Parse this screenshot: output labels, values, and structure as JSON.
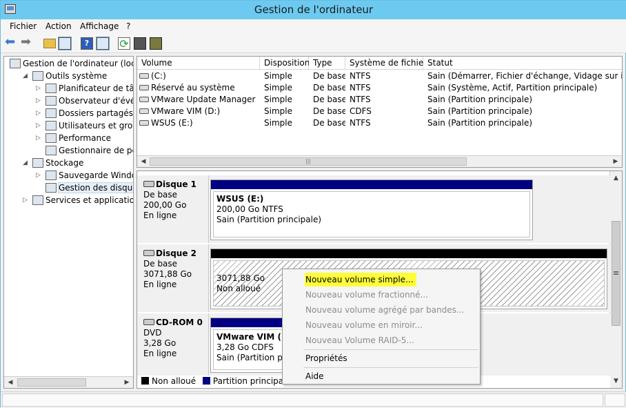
{
  "window": {
    "title": "Gestion de l'ordinateur"
  },
  "menu": [
    "Fichier",
    "Action",
    "Affichage",
    "?"
  ],
  "tree": [
    {
      "label": "Gestion de l'ordinateur (local)",
      "level": 0,
      "exp": ""
    },
    {
      "label": "Outils système",
      "level": 1,
      "exp": "◢"
    },
    {
      "label": "Planificateur de tâches",
      "level": 2,
      "exp": "▷"
    },
    {
      "label": "Observateur d'événeme",
      "level": 2,
      "exp": "▷"
    },
    {
      "label": "Dossiers partagés",
      "level": 2,
      "exp": "▷"
    },
    {
      "label": "Utilisateurs et groupes l",
      "level": 2,
      "exp": "▷"
    },
    {
      "label": "Performance",
      "level": 2,
      "exp": "▷"
    },
    {
      "label": "Gestionnaire de périphé",
      "level": 2,
      "exp": ""
    },
    {
      "label": "Stockage",
      "level": 1,
      "exp": "◢"
    },
    {
      "label": "Sauvegarde Windows Se",
      "level": 2,
      "exp": "▷"
    },
    {
      "label": "Gestion des disques",
      "level": 2,
      "exp": "",
      "selected": true
    },
    {
      "label": "Services et applications",
      "level": 1,
      "exp": "▷"
    }
  ],
  "volumes": {
    "headers": [
      "Volume",
      "Disposition",
      "Type",
      "Système de fichiers",
      "Statut"
    ],
    "rows": [
      [
        "(C:)",
        "Simple",
        "De base",
        "NTFS",
        "Sain (Démarrer, Fichier d'échange, Vidage sur incident"
      ],
      [
        "Réservé au système",
        "Simple",
        "De base",
        "NTFS",
        "Sain (Système, Actif, Partition principale)"
      ],
      [
        "VMware Update Manager (F:)",
        "Simple",
        "De base",
        "NTFS",
        "Sain (Partition principale)"
      ],
      [
        "VMware VIM (D:)",
        "Simple",
        "De base",
        "CDFS",
        "Sain (Partition principale)"
      ],
      [
        "WSUS (E:)",
        "Simple",
        "De base",
        "NTFS",
        "Sain (Partition principale)"
      ]
    ]
  },
  "disks": [
    {
      "name": "Disque 1",
      "type": "De base",
      "size": "200,00 Go",
      "state": "En ligne",
      "partition": {
        "name": "WSUS  (E:)",
        "line1": "200,00 Go NTFS",
        "line2": "Sain (Partition principale)"
      }
    },
    {
      "name": "Disque 2",
      "type": "De base",
      "size": "3071,88 Go",
      "state": "En ligne",
      "partition": {
        "name": "",
        "line1": "3071,88 Go",
        "line2": "Non alloué"
      }
    },
    {
      "name": "CD-ROM 0",
      "type": "DVD",
      "size": "3,28 Go",
      "state": "En ligne",
      "partition": {
        "name": "VMware VIM  (D:)",
        "line1": "3,28 Go CDFS",
        "line2": "Sain (Partition principale)"
      }
    }
  ],
  "legend": {
    "unallocated": "Non alloué",
    "primary": "Partition principale"
  },
  "context_menu": {
    "new_simple": "Nouveau volume simple...",
    "new_spanned": "Nouveau volume fractionné...",
    "new_striped": "Nouveau volume agrégé par bandes...",
    "new_mirror": "Nouveau volume en miroir...",
    "new_raid5": "Nouveau Volume RAID-5...",
    "properties": "Propriétés",
    "help": "Aide"
  },
  "colors": {
    "titlebar": "#6ccaf0",
    "primary_partition": "#000080",
    "unallocated": "#000000",
    "highlight": "#fffd3a"
  }
}
